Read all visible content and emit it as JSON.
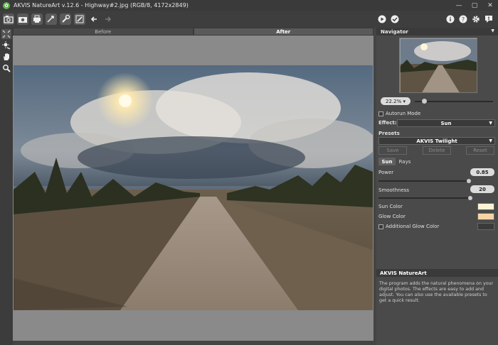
{
  "window": {
    "title": "AKVIS NatureArt v.12.6 - Highway#2.jpg (RGB/8, 4172x2849)"
  },
  "canvas_tabs": [
    {
      "label": "Before"
    },
    {
      "label": "After"
    }
  ],
  "navigator": {
    "title": "Navigator",
    "zoom": "22.2%"
  },
  "settings": {
    "autorun_label": "Autorun Mode",
    "effect_label": "Effect:",
    "effect_value": "Sun",
    "presets_label": "Presets",
    "preset_value": "AKVIS Twilight",
    "save_label": "Save",
    "delete_label": "Delete",
    "reset_label": "Reset",
    "subtabs": [
      {
        "label": "Sun"
      },
      {
        "label": "Rays"
      }
    ],
    "power_label": "Power",
    "power_value": "0.85",
    "smoothness_label": "Smoothness",
    "smoothness_value": "20",
    "sun_color_label": "Sun Color",
    "sun_color": "#fdf3d4",
    "glow_color_label": "Glow Color",
    "glow_color": "#f5d3a8",
    "additional_glow_label": "Additional Glow Color",
    "additional_glow_color": "#3a3a3a"
  },
  "info": {
    "title": "AKVIS NatureArt",
    "text": "The program adds the natural phenomena on your digital photos. The effects are easy to add and adjust. You can also use the available presets to get a quick result."
  }
}
